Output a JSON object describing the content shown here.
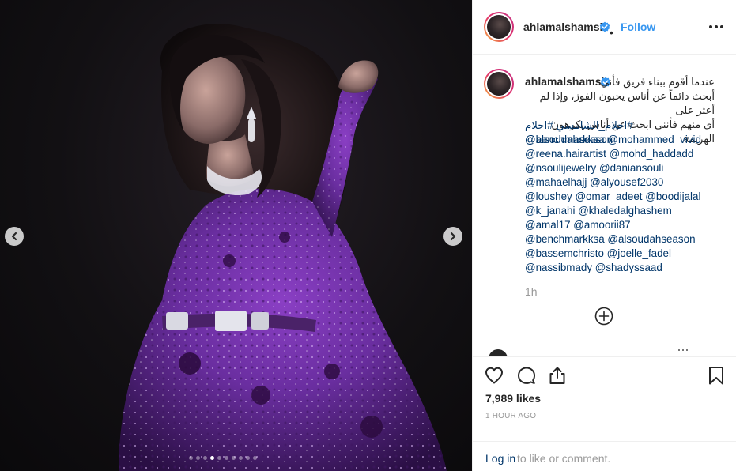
{
  "post": {
    "username": "ahlamalshamsi",
    "follow_label": "Follow",
    "follow_separator": "•",
    "caption_arabic": [
      "عندما أقوم ببناء فريق فأني",
      "أبحث دائماً عن أناس يحبون الفوز، وإذا لم أعثر على",
      "أي منهم فأنني ابحث عن أناس يكرهون الهزيمة"
    ],
    "hashtags_arabic": "#احلام_الشامسي #احلام",
    "mentions": [
      "@alsoudahseason",
      "@benchmarkksa @mohammed_vivid",
      "@reena.hairartist @mohd_haddadd",
      "@nsoulijewelry @daniansouli",
      "@mahaelhajj @alyousef2030",
      "@loushey @omar_adeet @boodijalal",
      "@k_janahi @khaledalghashem",
      "@amal17 @amoorii87",
      "@benchmarkksa @alsoudahseason",
      "@bassemchristo @joelle_fadel",
      "@nassibmady @shadyssaad"
    ],
    "comment_age": "1h",
    "likes_text": "7,989 likes",
    "posted_time": "1 HOUR AGO",
    "login_link": "Log in",
    "login_rest": "to like or comment."
  },
  "carousel": {
    "total": 10,
    "active": 3
  },
  "icons": {
    "verified": "verified-badge-icon",
    "more": "more-options-icon",
    "like": "heart-icon",
    "comment": "comment-bubble-icon",
    "share": "share-icon",
    "save": "bookmark-icon",
    "load_more": "plus-circle-icon",
    "prev": "chevron-left-icon",
    "next": "chevron-right-icon"
  },
  "colors": {
    "link": "#003569",
    "follow": "#3897f0",
    "verified": "#3897f0",
    "muted": "#999999",
    "dress": "#6a2ea0"
  }
}
